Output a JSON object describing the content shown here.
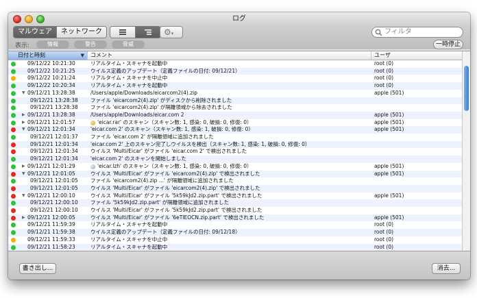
{
  "window": {
    "title": "ログ",
    "tabs": [
      {
        "label": "マルウェア",
        "active": true
      },
      {
        "label": "ネットワーク",
        "active": false
      }
    ],
    "search_placeholder": "フィルタ"
  },
  "filter": {
    "label": "表示:",
    "pills": [
      "情報",
      "警告",
      "脅威"
    ],
    "pause_button": "一時停止"
  },
  "table": {
    "headers": {
      "time": "日付と時刻",
      "comment": "コメント",
      "user": "ユーザ"
    },
    "rows": [
      {
        "status": "green",
        "disclosure": "none",
        "indent": false,
        "time": "09/12/22 10:21:30",
        "comment": "リアルタイム・スキャナを起動中",
        "user": "root (0)"
      },
      {
        "status": "green",
        "disclosure": "none",
        "indent": false,
        "time": "09/12/22 10:21:25",
        "comment": "ウイルス定義のアップデート（定義ファイルの日付: 09/12/21）",
        "user": "root (0)"
      },
      {
        "status": "yellow",
        "disclosure": "none",
        "indent": false,
        "time": "09/12/22 10:21:24",
        "comment": "リアルタイム・スキャナを中止中",
        "user": "root (0)"
      },
      {
        "status": "green",
        "disclosure": "none",
        "indent": false,
        "time": "09/12/22 10:20:34",
        "comment": "リアルタイム・スキャナを起動中",
        "user": "root (0)"
      },
      {
        "status": "green",
        "disclosure": "open",
        "indent": false,
        "time": "09/12/21 13:28:38",
        "comment": "/Users/apple/Downloads/eicarcom2(4).zip",
        "user": "apple (501)"
      },
      {
        "status": "green",
        "disclosure": "none",
        "indent": true,
        "time": "09/12/21 13:28:38",
        "comment": "ファイル 'eicarcom2(4).zip' がディスクから削除されました",
        "user": ""
      },
      {
        "status": "green",
        "disclosure": "none",
        "indent": true,
        "time": "09/12/21 13:28:38",
        "comment": "ファイル 'eicarcom2(4).zip' が隔離領域から除去されました",
        "user": ""
      },
      {
        "status": "green",
        "disclosure": "closed",
        "indent": false,
        "time": "09/12/21 13:28:38",
        "comment": "/Users/apple/Downloads/eicar.com 2",
        "user": "apple (501)"
      },
      {
        "status": "green",
        "disclosure": "closed",
        "indent": false,
        "time": "09/12/21 12:01:57",
        "comment": "'eicar.rar' のスキャン（スキャン数: 1, 感染: 0, 破損: 0, 修復: 0）",
        "user": "apple (501)",
        "icon": "archive"
      },
      {
        "status": "red",
        "disclosure": "open",
        "indent": false,
        "time": "09/12/21 12:01:34",
        "comment": "'eicar.com 2' のスキャン（スキャン数: 1, 感染: 1, 破損: 0, 修復: 0）",
        "user": "apple (501)"
      },
      {
        "status": "green",
        "disclosure": "none",
        "indent": true,
        "time": "09/12/21 12:01:37",
        "comment": "ファイル 'eicar.com 2' が隔離領域に追加されました",
        "user": ""
      },
      {
        "status": "red",
        "disclosure": "none",
        "indent": true,
        "time": "09/12/21 12:01:34",
        "comment": "'eicar.com 2' 上のスキャン完了しウイルスを検出（スキャン数: 1, 感染: 1, 破損: 0, 修復: 0）",
        "user": ""
      },
      {
        "status": "red",
        "disclosure": "none",
        "indent": true,
        "time": "09/12/21 12:01:34",
        "comment": "ウイルス 'Multi/Eicar' がファイル 'eicar.com 2' で検出されました",
        "user": ""
      },
      {
        "status": "green",
        "disclosure": "none",
        "indent": true,
        "time": "09/12/21 12:01:34",
        "comment": "'eicar.com 2' のスキャンを開始しました",
        "user": ""
      },
      {
        "status": "green",
        "disclosure": "closed",
        "indent": false,
        "time": "09/12/21 12:01:29",
        "comment": "'eicar.lzh' のスキャン（スキャン数: 1, 感染: 0, 破損: 0, 修復: 0）",
        "user": "apple (501)",
        "icon": "disk"
      },
      {
        "status": "red",
        "disclosure": "open",
        "indent": false,
        "time": "09/12/21 12:01:05",
        "comment": "ウイルス 'Multi/Eicar' がファイル 'eicarcom2(4).zip' で検出されました",
        "user": "apple (501)"
      },
      {
        "status": "green",
        "disclosure": "none",
        "indent": true,
        "time": "09/12/21 12:01:05",
        "comment": "ファイル 'eicarcom2(4).zip ...' が隔離領域に追加されました",
        "user": ""
      },
      {
        "status": "red",
        "disclosure": "none",
        "indent": true,
        "time": "09/12/21 12:01:05",
        "comment": "ウイルス 'Multi/Eicar' がファイル 'eicarcom2(4).zip' で検出されました",
        "user": ""
      },
      {
        "status": "red",
        "disclosure": "open",
        "indent": false,
        "time": "09/12/21 12:00:10",
        "comment": "ウイルス 'Multi/Eicar' がファイル '5k59kJd2.zip.part' で検出されました",
        "user": "apple (501)"
      },
      {
        "status": "green",
        "disclosure": "none",
        "indent": true,
        "time": "09/12/21 12:00:10",
        "comment": "ファイル '5k59kJd2.zip.part' が隔離領域に追加されました",
        "user": ""
      },
      {
        "status": "red",
        "disclosure": "none",
        "indent": true,
        "time": "09/12/21 12:00:10",
        "comment": "ウイルス 'Multi/Eicar' がファイル '5k59kJd2.zip.part' で検出されました",
        "user": ""
      },
      {
        "status": "red",
        "disclosure": "closed",
        "indent": false,
        "time": "09/12/21 12:00:05",
        "comment": "ウイルス 'Multi/Eicar' がファイル '6eTIEOCN.zip.part' で検出されました",
        "user": "apple (501)"
      },
      {
        "status": "green",
        "disclosure": "none",
        "indent": false,
        "time": "09/12/21 11:59:39",
        "comment": "リアルタイム・スキャナを起動中",
        "user": "root (0)"
      },
      {
        "status": "green",
        "disclosure": "none",
        "indent": false,
        "time": "09/12/21 11:59:38",
        "comment": "ウイルス定義のアップデート（定義ファイルの日付: 09/12/18）",
        "user": "root (0)"
      },
      {
        "status": "yellow",
        "disclosure": "none",
        "indent": false,
        "time": "09/12/21 11:59:33",
        "comment": "リアルタイム・スキャナを中止中",
        "user": "root (0)"
      },
      {
        "status": "green",
        "disclosure": "none",
        "indent": false,
        "time": "09/12/21 11:58:23",
        "comment": "リアルタイム・スキャナを起動中",
        "user": "root (0)"
      }
    ]
  },
  "bottom": {
    "export_button": "書き出し...",
    "clear_button": "消去..."
  },
  "colors": {
    "green": "#2cc23a",
    "yellow": "#f0b400",
    "red": "#e22a20",
    "selection": "#3f7cd0"
  }
}
